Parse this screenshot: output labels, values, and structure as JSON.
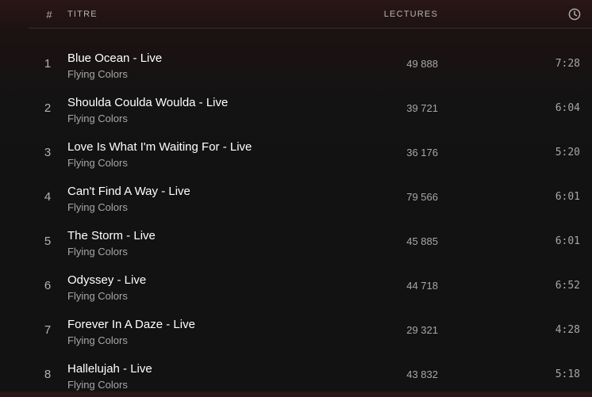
{
  "header": {
    "number_symbol": "#",
    "title_label": "TITRE",
    "plays_label": "LECTURES",
    "duration_icon": "clock-icon"
  },
  "tracks": [
    {
      "number": "1",
      "title": "Blue Ocean - Live",
      "artist": "Flying Colors",
      "plays": "49 888",
      "duration": "7:28"
    },
    {
      "number": "2",
      "title": "Shoulda Coulda Woulda - Live",
      "artist": "Flying Colors",
      "plays": "39 721",
      "duration": "6:04"
    },
    {
      "number": "3",
      "title": "Love Is What I'm Waiting For - Live",
      "artist": "Flying Colors",
      "plays": "36 176",
      "duration": "5:20"
    },
    {
      "number": "4",
      "title": "Can't Find A Way - Live",
      "artist": "Flying Colors",
      "plays": "79 566",
      "duration": "6:01"
    },
    {
      "number": "5",
      "title": "The Storm - Live",
      "artist": "Flying Colors",
      "plays": "45 885",
      "duration": "6:01"
    },
    {
      "number": "6",
      "title": "Odyssey - Live",
      "artist": "Flying Colors",
      "plays": "44 718",
      "duration": "6:52"
    },
    {
      "number": "7",
      "title": "Forever In A Daze - Live",
      "artist": "Flying Colors",
      "plays": "29 321",
      "duration": "4:28"
    },
    {
      "number": "8",
      "title": "Hallelujah - Live",
      "artist": "Flying Colors",
      "plays": "43 832",
      "duration": "5:18"
    }
  ],
  "colors": {
    "background": "#121212",
    "text_primary": "#ffffff",
    "text_secondary": "#a7a7a7"
  }
}
